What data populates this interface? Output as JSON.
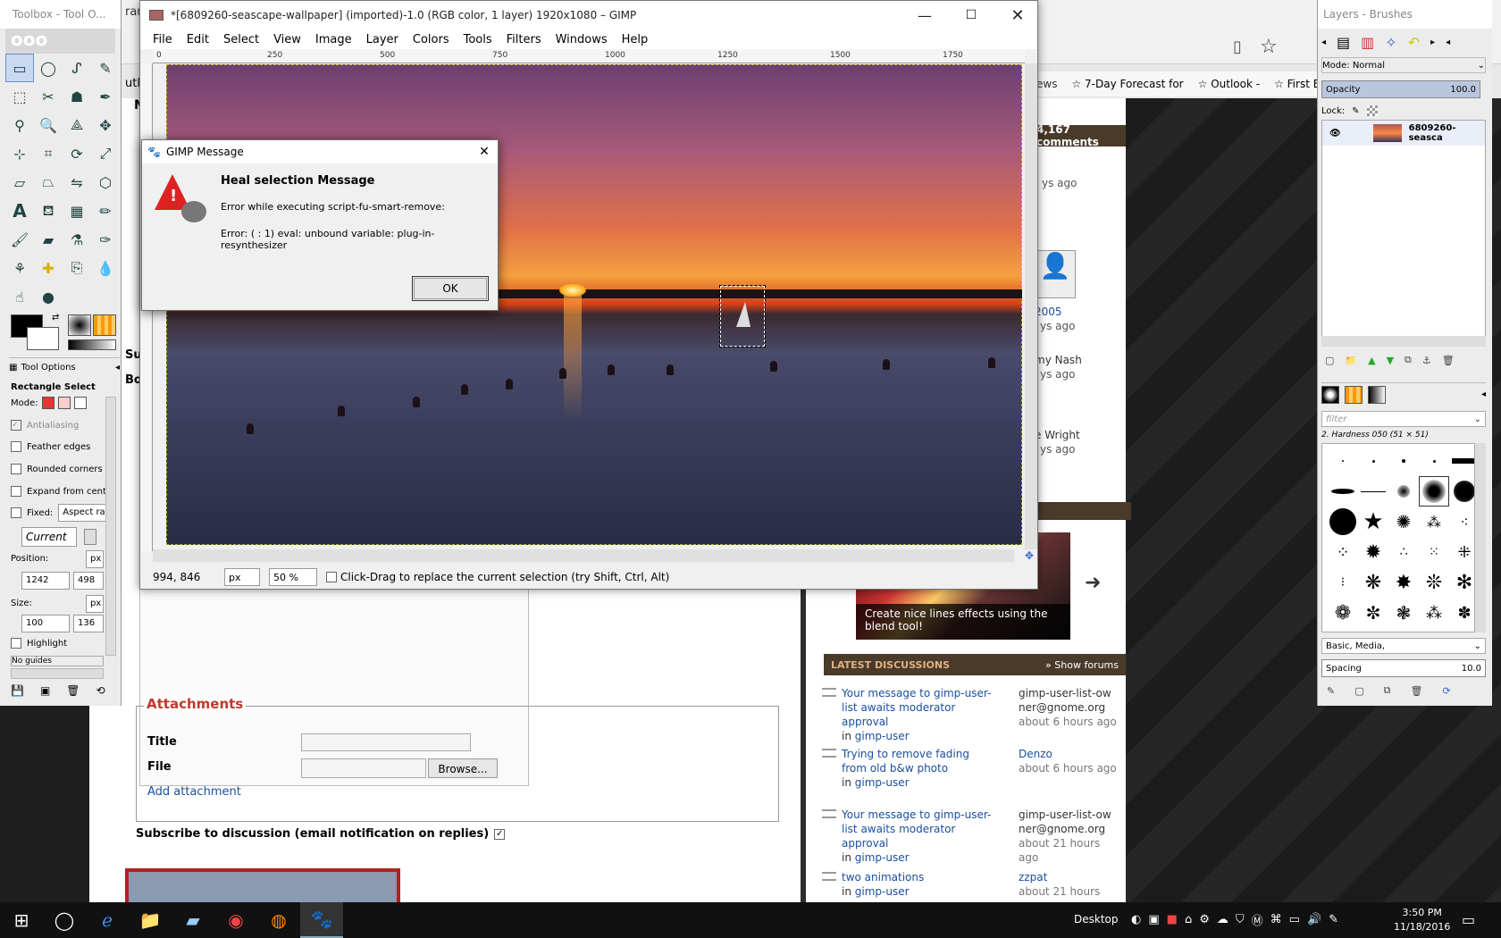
{
  "background_browser": {
    "bookmarks": [
      "7-Day Forecast for",
      "Outlook -",
      "First Ba"
    ],
    "partial_left_text": [
      "ram -",
      "utlook",
      "Ma"
    ],
    "comments_badge": "4,167 comments",
    "side_times": [
      "ys ago",
      "ys ago",
      "ys ago",
      "ys ago"
    ],
    "side_names": [
      "2005",
      "my Nash",
      "e Wright"
    ],
    "blend_caption": "Create nice lines effects using the blend tool!",
    "latest_discussions_title": "LATEST DISCUSSIONS",
    "show_forums": "Show forums",
    "discussions": [
      {
        "title": "Your message to gimp-user-list awaits moderator approval",
        "forum_prefix": "in",
        "forum": "gimp-user",
        "author": "gimp-user-list-owner@gnome.org",
        "time": "about 6 hours ago"
      },
      {
        "title": "Trying to remove fading from old b&w photo",
        "forum_prefix": "in",
        "forum": "gimp-user",
        "author": "Denzo",
        "time": "about 6 hours ago"
      },
      {
        "title": "Your message to gimp-user-list awaits moderator approval",
        "forum_prefix": "in",
        "forum": "gimp-user",
        "author": "gimp-user-list-owner@gnome.org",
        "time": "about 21 hours ago"
      },
      {
        "title": "two animations",
        "forum_prefix": "in",
        "forum": "gimp-user",
        "author": "zzpat",
        "time": "about 21 hours ago"
      }
    ],
    "form": {
      "left_partial": [
        "Su",
        "Bo"
      ],
      "attachments_legend": "Attachments",
      "title_label": "Title",
      "file_label": "File",
      "browse_button": "Browse...",
      "add_attachment": "Add attachment",
      "subscribe_label": "Subscribe to discussion (email notification on replies)"
    }
  },
  "toolbox": {
    "title": "Toolbox - Tool O...",
    "tool_options_tab": "Tool Options",
    "tool_name": "Rectangle Select",
    "mode_label": "Mode:",
    "antialiasing": "Antialiasing",
    "feather_edges": "Feather edges",
    "rounded_corners": "Rounded corners",
    "expand_from_center": "Expand from cente",
    "fixed_label": "Fixed:",
    "fixed_value": "Aspect ratio",
    "current_value": "Current",
    "position_label": "Position:",
    "position_x": "1242",
    "position_y": "498",
    "size_label": "Size:",
    "size_w": "100",
    "size_h": "136",
    "unit": "px",
    "highlight": "Highlight",
    "guides": "No guides"
  },
  "gimp": {
    "window_title": "*[6809260-seascape-wallpaper] (imported)-1.0 (RGB color, 1 layer) 1920x1080 – GIMP",
    "menus": [
      "File",
      "Edit",
      "Select",
      "View",
      "Image",
      "Layer",
      "Colors",
      "Tools",
      "Filters",
      "Windows",
      "Help"
    ],
    "ruler_ticks": [
      "0",
      "250",
      "500",
      "750",
      "1000",
      "1250",
      "1500",
      "1750"
    ],
    "coords": "994, 846",
    "unit": "px",
    "zoom": "50 %",
    "status_hint": "Click-Drag to replace the current selection (try Shift, Ctrl, Alt)"
  },
  "message": {
    "window_title": "GIMP Message",
    "heading": "Heal selection Message",
    "line1": "Error while executing script-fu-smart-remove:",
    "line2": "Error: ( : 1) eval: unbound variable: plug-in-resynthesizer",
    "ok": "OK"
  },
  "layers": {
    "title": "Layers - Brushes",
    "mode_label": "Mode:",
    "mode_value": "Normal",
    "opacity_label": "Opacity",
    "opacity_value": "100.0",
    "lock_label": "Lock:",
    "layer_name": "6809260-seasca",
    "filter_placeholder": "filter",
    "brush_name": "2. Hardness 050 (51 × 51)",
    "brush_tags": "Basic, Media,",
    "spacing_label": "Spacing",
    "spacing_value": "10.0"
  },
  "taskbar": {
    "desktop_label": "Desktop",
    "time": "3:50 PM",
    "date": "11/18/2016"
  },
  "colors": {
    "accent_red": "#c0392b",
    "link_blue": "#1a4fa0",
    "gimp_select": "#c9d9f2",
    "taskbar": "#111111"
  }
}
